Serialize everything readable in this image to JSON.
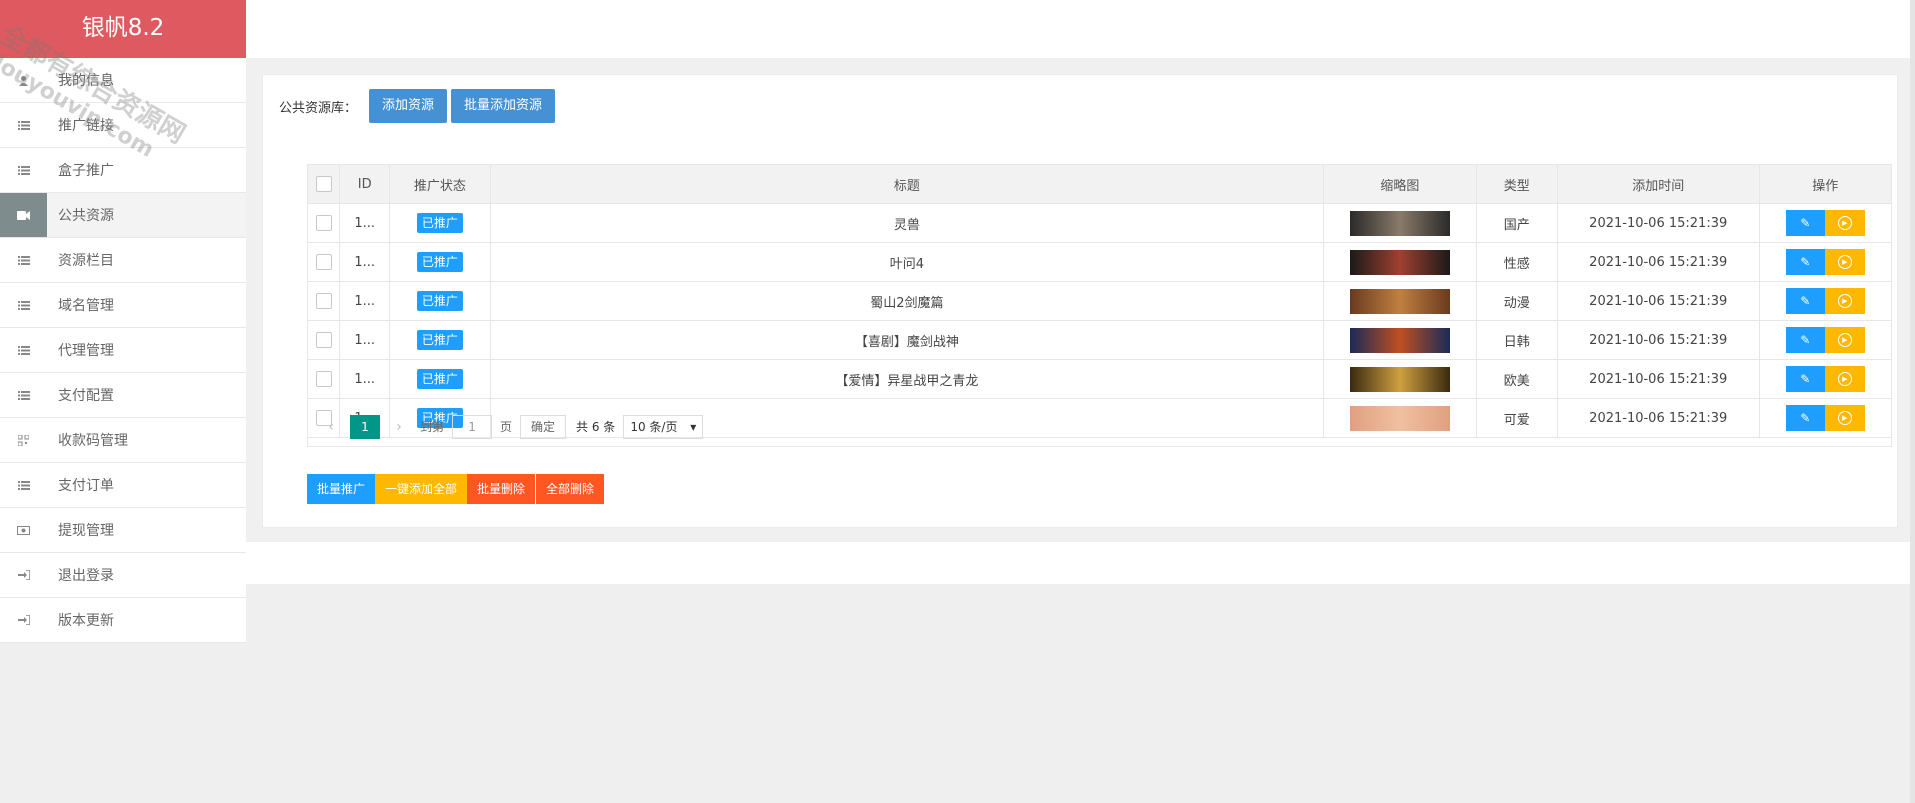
{
  "app": {
    "title": "银帆8.2"
  },
  "watermark": {
    "line1": "全都有综合资源网",
    "line2": "douyouvip.com"
  },
  "sidebar": {
    "items": [
      {
        "label": "我的信息",
        "icon": "user-icon",
        "active": false
      },
      {
        "label": "推广链接",
        "icon": "list-icon",
        "active": false
      },
      {
        "label": "盒子推广",
        "icon": "list-icon",
        "active": false
      },
      {
        "label": "公共资源",
        "icon": "video-camera-icon",
        "active": true
      },
      {
        "label": "资源栏目",
        "icon": "list-icon",
        "active": false
      },
      {
        "label": "域名管理",
        "icon": "list-icon",
        "active": false
      },
      {
        "label": "代理管理",
        "icon": "list-icon",
        "active": false
      },
      {
        "label": "支付配置",
        "icon": "list-icon",
        "active": false
      },
      {
        "label": "收款码管理",
        "icon": "qrcode-icon",
        "active": false
      },
      {
        "label": "支付订单",
        "icon": "list-icon",
        "active": false
      },
      {
        "label": "提现管理",
        "icon": "money-icon",
        "active": false
      },
      {
        "label": "退出登录",
        "icon": "sign-in-icon",
        "active": false
      },
      {
        "label": "版本更新",
        "icon": "sign-in-icon",
        "active": false
      }
    ]
  },
  "toolbar": {
    "label": "公共资源库：",
    "add_label": "添加资源",
    "batch_add_label": "批量添加资源"
  },
  "table": {
    "headers": [
      "ID",
      "推广状态",
      "标题",
      "缩略图",
      "类型",
      "添加时间",
      "操作"
    ],
    "rows": [
      {
        "id": "1...",
        "status": "已推广",
        "title": "灵兽",
        "type": "国产",
        "time": "2021-10-06 15:21:39",
        "thumb_colors": [
          "#2a2a2a",
          "#8a7a6a"
        ]
      },
      {
        "id": "1...",
        "status": "已推广",
        "title": "叶问4",
        "type": "性感",
        "time": "2021-10-06 15:21:39",
        "thumb_colors": [
          "#1a1a1a",
          "#a04030"
        ]
      },
      {
        "id": "1...",
        "status": "已推广",
        "title": "蜀山2剑魔篇",
        "type": "动漫",
        "time": "2021-10-06 15:21:39",
        "thumb_colors": [
          "#6a3a20",
          "#c08040"
        ]
      },
      {
        "id": "1...",
        "status": "已推广",
        "title": "【喜剧】魔剑战神",
        "type": "日韩",
        "time": "2021-10-06 15:21:39",
        "thumb_colors": [
          "#1a2a5a",
          "#c05020"
        ]
      },
      {
        "id": "1...",
        "status": "已推广",
        "title": "【爱情】异星战甲之青龙",
        "type": "欧美",
        "time": "2021-10-06 15:21:39",
        "thumb_colors": [
          "#3a2a10",
          "#d0a040"
        ]
      },
      {
        "id": "1...",
        "status": "已推广",
        "title": "",
        "type": "可爱",
        "time": "2021-10-06 15:21:39",
        "thumb_colors": [
          "#e0a080",
          "#f0c0a0"
        ]
      }
    ]
  },
  "pager": {
    "current": "1",
    "goto_label": "到第",
    "goto_value": "1",
    "page_unit": "页",
    "confirm": "确定",
    "total": "共 6 条",
    "page_size": "10 条/页"
  },
  "bottom": {
    "batch_promote": "批量推广",
    "add_all": "一键添加全部",
    "batch_delete": "批量删除",
    "delete_all": "全部删除"
  },
  "colors": {
    "brand": "#de5a60",
    "primary": "#1e9fff",
    "warn": "#ffb800",
    "danger": "#ff5722",
    "pager": "#009688"
  }
}
